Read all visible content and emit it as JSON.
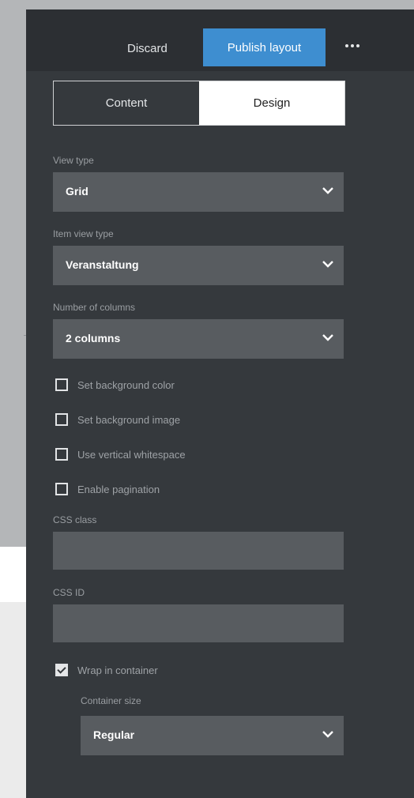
{
  "toolbar": {
    "discard_label": "Discard",
    "publish_label": "Publish layout",
    "more_icon": "more-horizontal-icon"
  },
  "tabs": [
    {
      "label": "Content"
    },
    {
      "label": "Design",
      "active": true
    }
  ],
  "fields": {
    "view_type": {
      "label": "View type",
      "value": "Grid"
    },
    "item_view_type": {
      "label": "Item view type",
      "value": "Veranstaltung"
    },
    "columns": {
      "label": "Number of columns",
      "value": "2 columns"
    },
    "checkboxes": [
      {
        "label": "Set background color",
        "checked": false
      },
      {
        "label": "Set background image",
        "checked": false
      },
      {
        "label": "Use vertical whitespace",
        "checked": false
      },
      {
        "label": "Enable pagination",
        "checked": false
      }
    ],
    "css_class": {
      "label": "CSS class",
      "value": ""
    },
    "css_id": {
      "label": "CSS ID",
      "value": ""
    },
    "wrap": {
      "label": "Wrap in container",
      "checked": true
    },
    "container_size": {
      "label": "Container size",
      "value": "Regular"
    }
  },
  "colors": {
    "accent": "#3e8ed0",
    "panel": "#35393d",
    "field": "#585c60"
  }
}
